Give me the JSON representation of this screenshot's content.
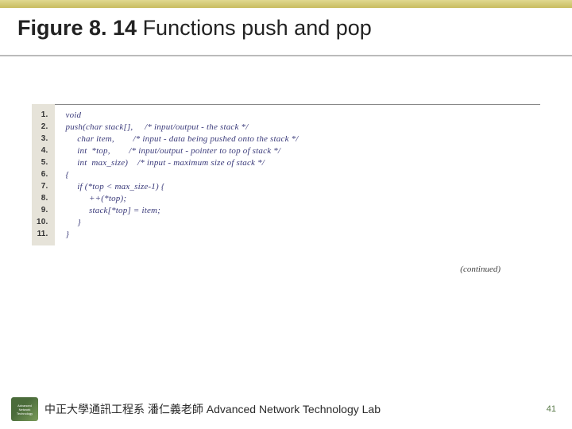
{
  "title_bold": "Figure 8. 14",
  "title_rest": "  Functions push and pop",
  "code": {
    "line_numbers": [
      "1.",
      "2.",
      "3.",
      "4.",
      "5.",
      "6.",
      "7.",
      "8.",
      "9.",
      "10.",
      "11."
    ],
    "lines": [
      "void",
      "push(char stack[],     /* input/output - the stack */",
      "     char item,        /* input - data being pushed onto the stack */",
      "     int  *top,        /* input/output - pointer to top of stack */",
      "     int  max_size)    /* input - maximum size of stack */",
      "{",
      "     if (*top < max_size-1) {",
      "          ++(*top);",
      "          stack[*top] = item;",
      "     }",
      "}"
    ]
  },
  "continued": "(continued)",
  "footer_zh": "中正大學通訊工程系 潘仁義老師  ",
  "footer_en": "Advanced Network Technology Lab",
  "page_number": "41",
  "logo_lines": [
    "Advanced",
    "Network",
    "Technology"
  ]
}
